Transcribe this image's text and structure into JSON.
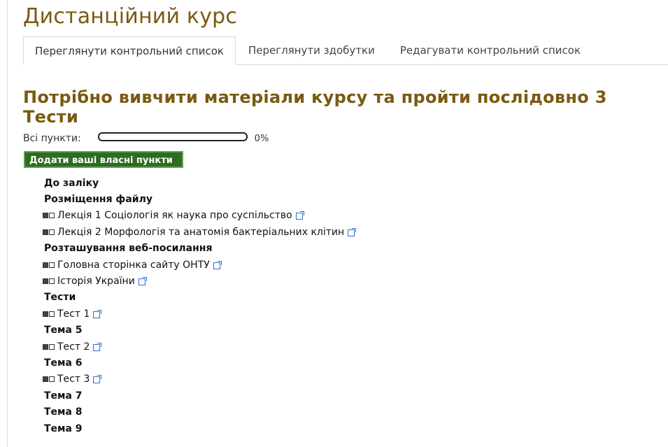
{
  "page_title": "Дистанційний курс",
  "tabs": [
    {
      "label": "Переглянути контрольний список",
      "active": true
    },
    {
      "label": "Переглянути здобутки",
      "active": false
    },
    {
      "label": "Редагувати контрольний список",
      "active": false
    }
  ],
  "heading": "Потрібно вивчити матеріали курсу та пройти послідовно 3 Тести",
  "progress": {
    "label": "Всі пункти:",
    "percent_text": "0%",
    "value": 0
  },
  "add_button_label": "Додати ваші власні пункти",
  "colors": {
    "title_brown": "#7a5a10",
    "button_green": "#2e6b23",
    "link_icon_blue": "#2a6bd6"
  },
  "checklist": [
    {
      "type": "heading",
      "text": "До заліку"
    },
    {
      "type": "heading",
      "text": "Розміщення файлу"
    },
    {
      "type": "item",
      "text": "Лекція 1 Соціологія як наука про суспільство",
      "icon": "external-link-icon"
    },
    {
      "type": "item",
      "text": "Лекція 2 Морфологія та анатомія бактеріальних клітин",
      "icon": "external-link-icon"
    },
    {
      "type": "heading",
      "text": "Розташування веб-посилання"
    },
    {
      "type": "item",
      "text": "Головна сторінка сайту ОНТУ",
      "icon": "external-link-icon"
    },
    {
      "type": "item",
      "text": "Історія України",
      "icon": "external-link-icon"
    },
    {
      "type": "heading",
      "text": "Тести"
    },
    {
      "type": "item",
      "text": "Тест 1",
      "icon": "external-link-icon"
    },
    {
      "type": "heading",
      "text": "Тема 5"
    },
    {
      "type": "item",
      "text": "Тест 2",
      "icon": "external-link-icon"
    },
    {
      "type": "heading",
      "text": "Тема 6"
    },
    {
      "type": "item",
      "text": "Тест 3",
      "icon": "external-link-icon"
    },
    {
      "type": "heading",
      "text": "Тема 7"
    },
    {
      "type": "heading",
      "text": "Тема 8"
    },
    {
      "type": "heading",
      "text": "Тема 9"
    }
  ]
}
